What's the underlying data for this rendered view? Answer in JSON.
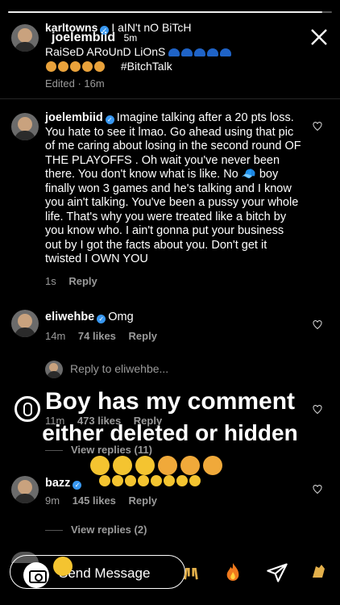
{
  "story": {
    "progress": 0.97,
    "close_icon": "close-icon"
  },
  "caption": {
    "username": "karltowns",
    "overlay_user": "joelembiid",
    "time": "5m",
    "line1": "I aIN't nO BiTcH",
    "line2": "RaiSeD ARoUnD LiOnS",
    "line3": "#BitchTalk",
    "edited": "Edited · 16m"
  },
  "comments": [
    {
      "username": "joelembiid",
      "text": "Imagine talking after a 20 pts loss. You hate to see it lmao. Go ahead using that pic of me caring about losing in the second round OF THE PLAYOFFS . Oh wait you've never been there. You don't know what is like. No 🧢 boy finally won 3 games and he's talking and I know you ain't talking. You've been a pussy your whole life. That's why you were treated like a bitch by you know who. I ain't gonna put your business out by I got the facts about you. Don't get it twisted I OWN YOU",
      "time": "1s",
      "reply": "Reply"
    },
    {
      "username": "eliwehbe",
      "text": "Omg",
      "time": "14m",
      "likes": "74 likes",
      "reply": "Reply"
    },
    {
      "time": "11m",
      "likes": "473 likes",
      "reply": "Reply",
      "view_replies": "View replies (11)"
    },
    {
      "username": "bazz",
      "time": "9m",
      "likes": "145 likes",
      "reply": "Reply",
      "view_replies": "View replies (2)"
    }
  ],
  "reply_to": "Reply to eliwehbe...",
  "overlay": {
    "line1": "Boy has my comment",
    "line2": "either deleted or hidden"
  },
  "bottom": {
    "send_placeholder": "Send Message"
  },
  "colors": {
    "verified": "#3897f0",
    "background": "#000000",
    "emoji": "#f4c430"
  }
}
